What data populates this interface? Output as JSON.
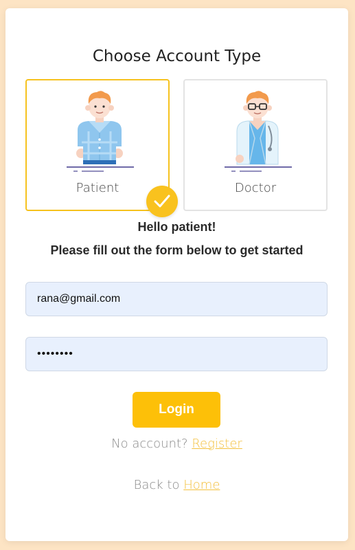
{
  "heading": "Choose Account Type",
  "account_types": [
    {
      "label": "Patient",
      "selected": true
    },
    {
      "label": "Doctor",
      "selected": false
    }
  ],
  "greeting": "Hello patient!",
  "instruction": "Please fill out the form below to get started",
  "form": {
    "email_value": "rana@gmail.com",
    "password_value": "password"
  },
  "login_label": "Login",
  "register_prompt": "No account?",
  "register_link": "Register",
  "back_prompt": "Back to",
  "home_link": "Home",
  "colors": {
    "accent": "#fdc008",
    "page_background": "#fde4c4",
    "input_background": "#e8f0fd",
    "link": "#f4c13f"
  }
}
